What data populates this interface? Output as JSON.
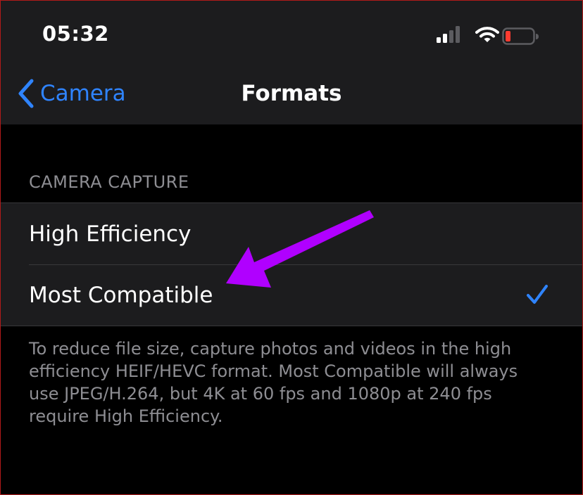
{
  "status_bar": {
    "time": "05:32"
  },
  "nav": {
    "back_label": "Camera",
    "title": "Formats"
  },
  "section": {
    "header": "CAMERA CAPTURE",
    "options": [
      {
        "label": "High Efficiency",
        "selected": false
      },
      {
        "label": "Most Compatible",
        "selected": true
      }
    ],
    "footer": "To reduce file size, capture photos and videos in the high efficiency HEIF/HEVC format. Most Compatible will always use JPEG/H.264, but 4K at 60 fps and 1080p at 240 fps require High Efficiency."
  },
  "colors": {
    "accent": "#2f84ff",
    "annotation_arrow": "#b000ff",
    "battery_low": "#ff3b30"
  },
  "icons": {
    "back": "chevron-left-icon",
    "check": "checkmark-icon",
    "signal": "cellular-signal-icon",
    "wifi": "wifi-icon",
    "battery": "battery-low-icon"
  }
}
